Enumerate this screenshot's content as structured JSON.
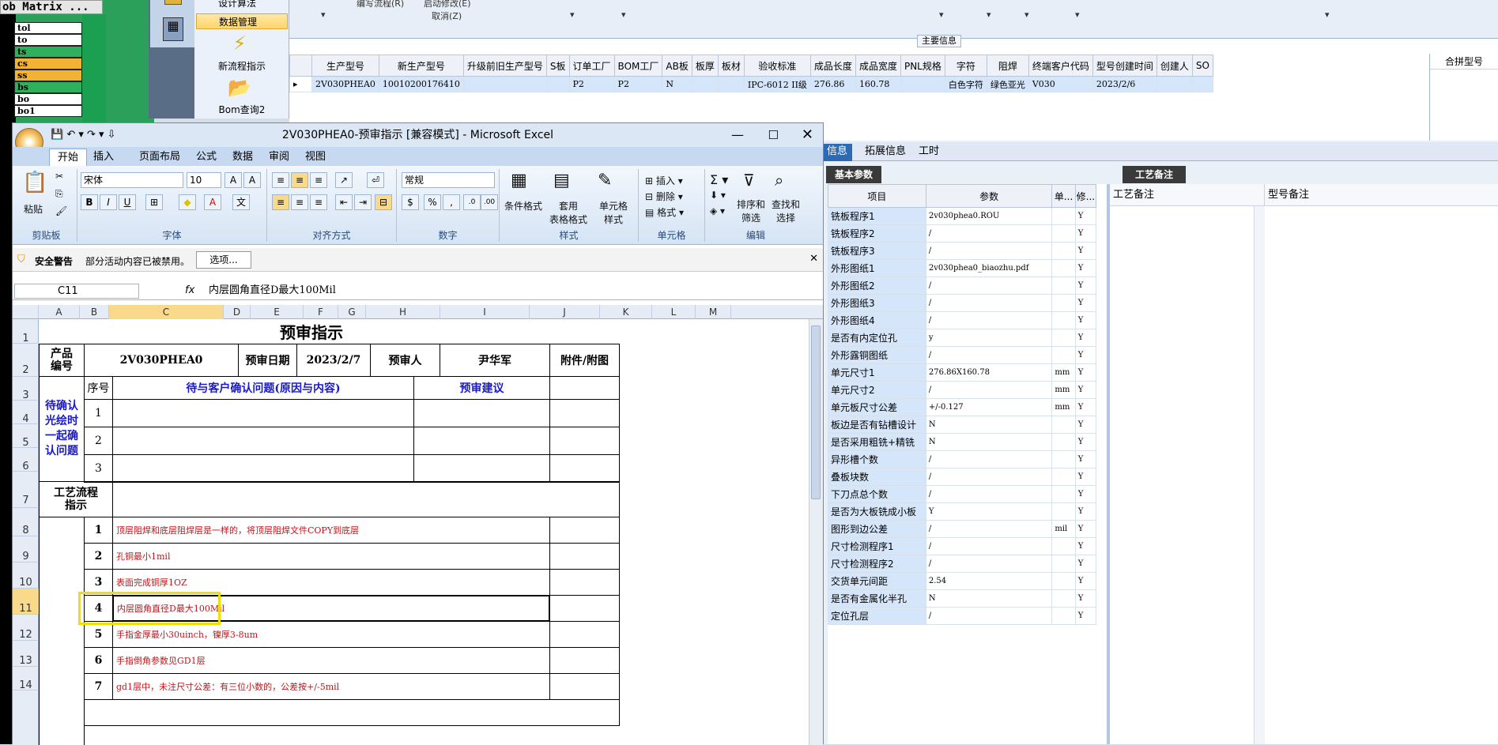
{
  "left": {
    "title": "ob Matrix ...",
    "rows": [
      {
        "text": "tol",
        "color": "w"
      },
      {
        "text": "to",
        "color": "w"
      },
      {
        "text": "ts",
        "color": "g"
      },
      {
        "text": "cs",
        "color": "y"
      },
      {
        "text": "ss",
        "color": "y"
      },
      {
        "text": "bs",
        "color": "g"
      },
      {
        "text": "bo",
        "color": "w"
      },
      {
        "text": "bo1",
        "color": "w"
      }
    ]
  },
  "nav": {
    "top_label": "设计算法",
    "selected": "数据管理",
    "new_flow": "新流程指示",
    "bom_query": "Bom查询2"
  },
  "topform": {
    "label1": "编写流程(R)",
    "label2": "启动修改(E)",
    "label3": "取消(Z)"
  },
  "main_grid": {
    "title": "主要信息",
    "columns": [
      "生产型号",
      "新生产型号",
      "升级前旧生产型号",
      "S板",
      "订单工厂",
      "BOM工厂",
      "AB板",
      "板厚",
      "板材",
      "验收标准",
      "成品长度",
      "成品宽度",
      "PNL规格",
      "字符",
      "阻焊",
      "终端客户代码",
      "型号创建时间",
      "创建人",
      "SO"
    ],
    "row": [
      "2V030PHEA0",
      "10010200176410",
      "",
      "",
      "P2",
      "P2",
      "N",
      "",
      "",
      "IPC-6012 II级",
      "276.86",
      "160.78",
      "",
      "白色字符",
      "绿色亚光",
      "V030",
      "2023/2/6",
      "",
      ""
    ],
    "side": "合拼型号"
  },
  "right": {
    "tabs": [
      "信息",
      "拓展信息",
      "工时"
    ],
    "basic_tab": "基本参数",
    "craft_tab": "工艺备注",
    "param_headers": [
      "项目",
      "参数",
      "单...",
      "修..."
    ],
    "params": [
      [
        "铣板程序1",
        "2v030phea0.ROU",
        "",
        "Y"
      ],
      [
        "铣板程序2",
        "/",
        "",
        "Y"
      ],
      [
        "铣板程序3",
        "/",
        "",
        "Y"
      ],
      [
        "外形图纸1",
        "2v030phea0_biaozhu.pdf",
        "",
        "Y"
      ],
      [
        "外形图纸2",
        "/",
        "",
        "Y"
      ],
      [
        "外形图纸3",
        "/",
        "",
        "Y"
      ],
      [
        "外形图纸4",
        "/",
        "",
        "Y"
      ],
      [
        "是否有内定位孔",
        "y",
        "",
        "Y"
      ],
      [
        "外形露铜图纸",
        "/",
        "",
        "Y"
      ],
      [
        "单元尺寸1",
        "276.86X160.78",
        "mm",
        "Y"
      ],
      [
        "单元尺寸2",
        "/",
        "mm",
        "Y"
      ],
      [
        "单元板尺寸公差",
        "+/-0.127",
        "mm",
        "Y"
      ],
      [
        "板边是否有钻槽设计",
        "N",
        "",
        "Y"
      ],
      [
        "是否采用粗铣+精铣",
        "N",
        "",
        "Y"
      ],
      [
        "异形槽个数",
        "/",
        "",
        "Y"
      ],
      [
        "叠板块数",
        "/",
        "",
        "Y"
      ],
      [
        "下刀点总个数",
        "/",
        "",
        "Y"
      ],
      [
        "是否为大板铣成小板",
        "Y",
        "",
        "Y"
      ],
      [
        "图形到边公差",
        "/",
        "mil",
        "Y"
      ],
      [
        "尺寸检测程序1",
        "/",
        "",
        "Y"
      ],
      [
        "尺寸检测程序2",
        "/",
        "",
        "Y"
      ],
      [
        "交货单元间距",
        "2.54",
        "",
        "Y"
      ],
      [
        "是否有金属化半孔",
        "N",
        "",
        "Y"
      ],
      [
        "定位孔层",
        "/",
        "",
        "Y"
      ]
    ],
    "craft_headers": [
      "工艺备注",
      "型号备注"
    ]
  },
  "excel": {
    "title": "2V030PHEA0-预审指示  [兼容模式] - Microsoft Excel",
    "tabs": [
      "开始",
      "插入",
      "页面布局",
      "公式",
      "数据",
      "审阅",
      "视图"
    ],
    "font": "宋体",
    "size": "10",
    "numfmt": "常规",
    "groups": [
      "剪贴板",
      "字体",
      "对齐方式",
      "数字",
      "样式",
      "单元格",
      "编辑"
    ],
    "clip": {
      "paste": "粘贴"
    },
    "style_btns": [
      "条件格式",
      "套用\n表格格式",
      "单元格\n样式"
    ],
    "cell_btns": [
      "插入",
      "删除",
      "格式"
    ],
    "edit_btns": [
      "排序和\n筛选",
      "查找和\n选择"
    ],
    "security": {
      "label": "安全警告",
      "msg": "部分活动内容已被禁用。",
      "btn": "选项..."
    },
    "namebox": "C11",
    "fx": "fx",
    "formula": "内层圆角直径D最大100Mil",
    "cols": [
      "A",
      "B",
      "C",
      "D",
      "E",
      "F",
      "G",
      "H",
      "I",
      "J",
      "K",
      "L",
      "M"
    ],
    "rows": [
      "1",
      "2",
      "3",
      "4",
      "5",
      "6",
      "7",
      "8",
      "9",
      "10",
      "11",
      "12",
      "13",
      "14"
    ],
    "sheet": {
      "title": "预审指示",
      "product_label": "产品\n编号",
      "product": "2V030PHEA0",
      "date_label": "预审日期",
      "date": "2023/2/7",
      "reviewer_label": "预审人",
      "reviewer": "尹华军",
      "attach": "附件/附图",
      "pending_label": "待确认\n光绘时\n一起确\n认问题",
      "seq": "序号",
      "q_header": "待与客户确认问题(原因与内容)",
      "advice": "预审建议",
      "q_nums": [
        "1",
        "2",
        "3"
      ],
      "flow_label": "工艺流程\n指示",
      "steps": [
        {
          "n": "1",
          "t": "顶层阻焊和底层阻焊层是一样的，将顶层阻焊文件COPY到底层"
        },
        {
          "n": "2",
          "t": "孔铜最小1mil"
        },
        {
          "n": "3",
          "t": "表面完成铜厚1OZ"
        },
        {
          "n": "4",
          "t": "内层圆角直径D最大100Mil"
        },
        {
          "n": "5",
          "t": "手指金厚最小30uinch，镍厚3-8um"
        },
        {
          "n": "6",
          "t": "手指倒角参数见GD1层"
        },
        {
          "n": "7",
          "t": "gd1层中，未注尺寸公差：有三位小数的，公差按+/-5mil"
        }
      ]
    }
  }
}
